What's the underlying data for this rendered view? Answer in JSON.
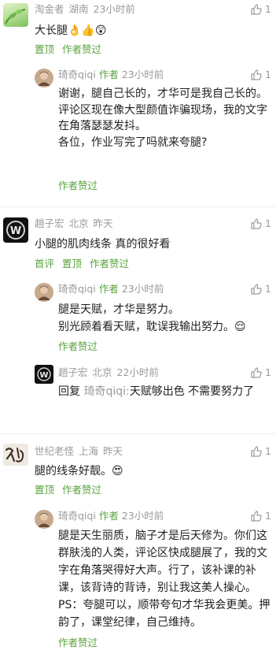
{
  "thread": [
    {
      "username": "淘金者",
      "location": "湖南",
      "time": "23小时前",
      "likes": "1",
      "text": "大长腿👌👍😲",
      "actions": [
        "置顶",
        "作者赞过"
      ],
      "replies": [
        {
          "username": "琦奇qiqi",
          "badge": "作者",
          "time": "23小时前",
          "likes": "1",
          "text": "谢谢，腿自己长的，才华可是我自己长的。\n评论区现在像大型颜值诈骗现场，我的文字在角落瑟瑟发抖。\n各位，作业写完了吗就来夸腿?",
          "actions": [
            "作者赞过"
          ]
        }
      ]
    },
    {
      "username": "趙子宏",
      "location": "北京",
      "time": "昨天",
      "likes": "1",
      "text": "小腿的肌肉线条 真的很好看",
      "actions": [
        "首评",
        "置顶",
        "作者赞过"
      ],
      "replies": [
        {
          "username": "琦奇qiqi",
          "badge": "作者",
          "time": "23小时前",
          "likes": "1",
          "text": "腿是天赋，才华是努力。\n别光顾着看天赋，耽误我输出努力。😌",
          "actions": [
            "作者赞过"
          ]
        },
        {
          "username": "趙子宏",
          "location": "北京",
          "time": "22小时前",
          "likes": "1",
          "reply_prefix": "回复",
          "reply_to": "琦奇qiqi:",
          "text": "天赋够出色 不需要努力了",
          "actions": []
        }
      ]
    },
    {
      "username": "世纪老怪",
      "location": "上海",
      "time": "昨天",
      "likes": "1",
      "text": "腿的线条好靓。😍",
      "actions": [
        "置顶",
        "作者赞过"
      ],
      "replies": [
        {
          "username": "琦奇qiqi",
          "badge": "作者",
          "time": "23小时前",
          "likes": "1",
          "text": "腿是天生丽质，脑子才是后天修为。你们这群肤浅的人类，评论区快成腿展了，我的文字在角落哭得好大声。行了，该补课的补课，该背诗的背诗，别让我这美人操心。PS：夸腿可以，顺带夸句才华我会更美。押韵了，课堂纪律，自己维持。",
          "actions": [
            "作者赞过"
          ]
        }
      ]
    }
  ],
  "colors": {
    "author_green": "#5aa33f",
    "meta_gray": "#9a9a9a",
    "divider": "#eeeeee"
  },
  "icons": {
    "like": "thumbs-up-icon"
  }
}
